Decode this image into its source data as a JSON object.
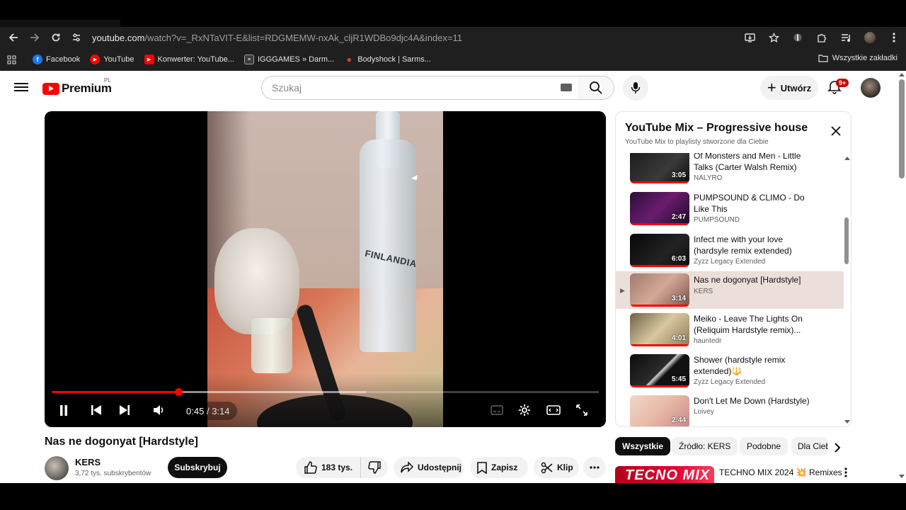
{
  "browser": {
    "url_host": "youtube.com",
    "url_path": "/watch?v=_RxNTaVIT-E&list=RDGMEMW-nxAk_cljR1WDBo9djc4A&index=11",
    "bookmarks": [
      {
        "label": "Facebook",
        "icon": "facebook-icon",
        "color": "#1877f2"
      },
      {
        "label": "YouTube",
        "icon": "youtube-icon",
        "color": "#ff0000"
      },
      {
        "label": "Konwerter: YouTube...",
        "icon": "youtube-icon",
        "color": "#ff0000"
      },
      {
        "label": "IGGGAMES » Darm...",
        "icon": "page-icon",
        "color": "#5f6368"
      },
      {
        "label": "Bodyshock | Sarms...",
        "icon": "flame-icon",
        "color": "#e8421f"
      }
    ],
    "all_bookmarks": "Wszystkie zakładki"
  },
  "header": {
    "logo_text": "Premium",
    "country": "PL",
    "search_placeholder": "Szukaj",
    "create_label": "Utwórz",
    "notifications_badge": "9+"
  },
  "player": {
    "current_time": "0:45",
    "duration": "3:14",
    "progress_fraction": 0.232,
    "buffer_fraction": 0.575,
    "overlay_text": "FINLANDIA"
  },
  "video": {
    "title": "Nas ne dogonyat [Hardstyle]",
    "channel": "KERS",
    "subscribers": "3,72 tys. subskrybentów",
    "subscribe_label": "Subskrybuj",
    "likes": "183 tys.",
    "share_label": "Udostępnij",
    "save_label": "Zapisz",
    "clip_label": "Klip"
  },
  "playlist": {
    "title": "YouTube Mix – Progressive house",
    "subtitle": "YouTube Mix to playlisty stworzone dla Ciebie",
    "items": [
      {
        "title": "Of Monsters and Men - Little Talks (Carter Walsh Remix)",
        "channel": "NALYRO",
        "duration": "3:05",
        "active": false
      },
      {
        "title": "PUMPSOUND & CLIMO - Do Like This",
        "channel": "PUMPSOUND",
        "duration": "2:47",
        "active": false
      },
      {
        "title": "Infect me with your love (hardsyle remix extended)",
        "channel": "Zyzz Legacy Extended",
        "duration": "6:03",
        "active": false
      },
      {
        "title": "Nas ne dogonyat [Hardstyle]",
        "channel": "KERS",
        "duration": "3:14",
        "active": true
      },
      {
        "title": "Meiko - Leave The Lights On (Reliquim Hardstyle remix)...",
        "channel": "hauntedr",
        "duration": "4:01",
        "active": false
      },
      {
        "title": "Shower (hardstyle remix extended)🔱",
        "channel": "Zyzz Legacy Extended",
        "duration": "5:45",
        "active": false
      },
      {
        "title": "Don't Let Me Down (Hardstyle)",
        "channel": "Loivey",
        "duration": "2:44",
        "active": false
      }
    ],
    "active_marker": "▶"
  },
  "chips": [
    "Wszystkie",
    "Źródło: KERS",
    "Podobne",
    "Dla Ciebie"
  ],
  "recommendation": {
    "thumb_text": "TECNO MIX",
    "title": "TECHNO MIX 2024 💥 Remixes"
  },
  "colors": {
    "youtube_red": "#ff0000",
    "progress_red": "#f00",
    "active_row": "#ecdfda"
  }
}
